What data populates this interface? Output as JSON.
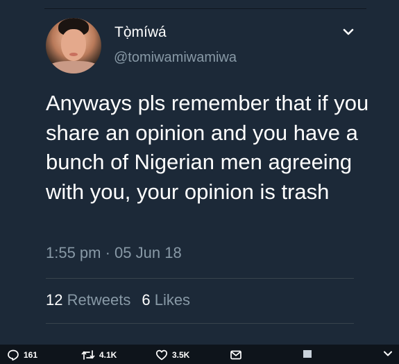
{
  "tweet": {
    "author_name": "Tọ̀míwá",
    "handle": "@tomiwamiwamiwa",
    "text": "Anyways pls remember that if you share an opinion and you have a bunch of Nigerian men agreeing with you, your opinion is trash",
    "timestamp": "1:55 pm · 05 Jun 18",
    "retweets_count": "12",
    "retweets_label": "Retweets",
    "likes_count": "6",
    "likes_label": "Likes"
  },
  "action_bar": {
    "reply_count": "161",
    "retweet_count": "4.1K",
    "like_count": "3.5K"
  },
  "icons": {
    "menu": "chevron-down-icon",
    "reply": "reply-icon",
    "retweet": "retweet-icon",
    "like": "heart-icon",
    "dm": "envelope-icon",
    "media": "image-thumbnail-icon",
    "more": "chevron-down-icon"
  }
}
